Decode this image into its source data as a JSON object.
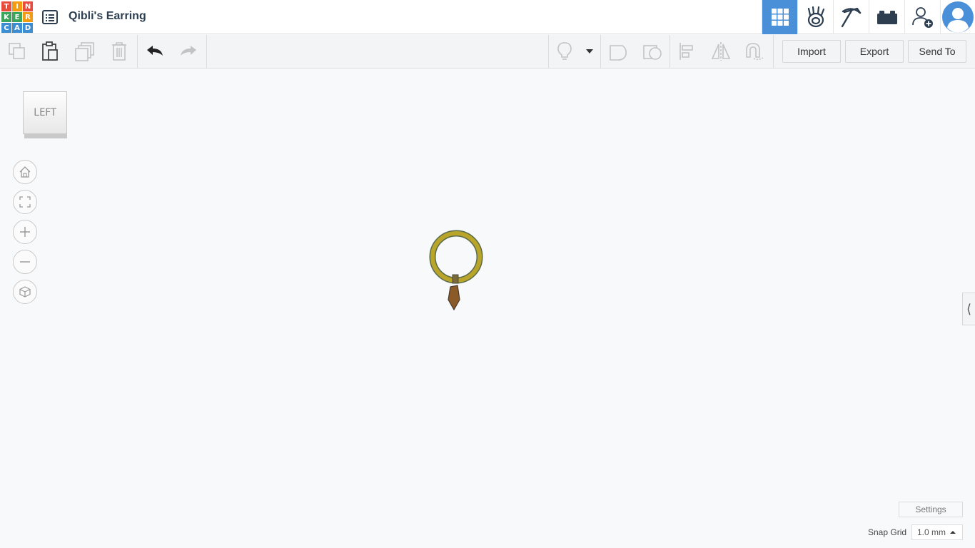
{
  "app": {
    "logo_letters": [
      "T",
      "I",
      "N",
      "K",
      "E",
      "R",
      "C",
      "A",
      "D"
    ],
    "logo_colors": [
      "#e74c3c",
      "#f39c12",
      "#e74c3c",
      "#3ca55c",
      "#3ca55c",
      "#f39c12",
      "#3c8dd1",
      "#3c8dd1",
      "#3c8dd1"
    ],
    "title": "Qibli's Earring"
  },
  "top_nav": {
    "items": [
      {
        "name": "3d-design-view",
        "icon": "grid-icon",
        "active": true
      },
      {
        "name": "blocks-view",
        "icon": "hand-bug-icon",
        "active": false
      },
      {
        "name": "minecraft-view",
        "icon": "pickaxe-icon",
        "active": false
      },
      {
        "name": "bricks-view",
        "icon": "brick-icon",
        "active": false
      },
      {
        "name": "invite-user",
        "icon": "add-user-icon",
        "active": false
      },
      {
        "name": "profile",
        "icon": "avatar-icon",
        "active": false
      }
    ],
    "accent": "#4a90d9"
  },
  "toolbar": {
    "import_label": "Import",
    "export_label": "Export",
    "send_to_label": "Send To"
  },
  "viewcube": {
    "face_label": "LEFT"
  },
  "nav_controls": [
    "home-icon",
    "fit-view-icon",
    "zoom-in-icon",
    "zoom-out-icon",
    "perspective-icon"
  ],
  "footer": {
    "settings_label": "Settings",
    "snap_grid_label": "Snap Grid",
    "snap_grid_value": "1.0 mm"
  },
  "colors": {
    "ring": "#b8a52a",
    "ring_outline": "#5a6a4a",
    "pendant": "#8a5a28",
    "ground_line": "#444444"
  }
}
